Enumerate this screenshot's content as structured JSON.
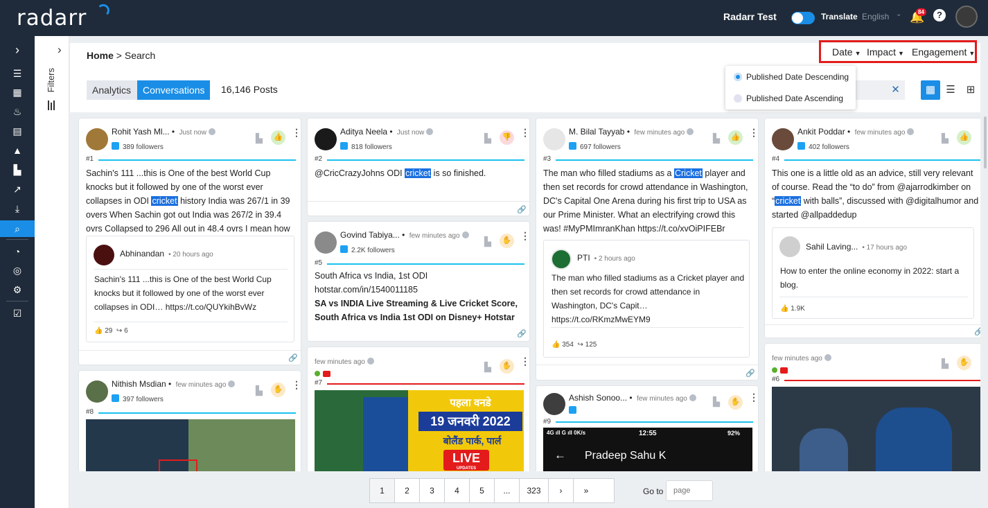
{
  "app": {
    "logo": "radarr",
    "account": "Radarr Test",
    "translate_label": "Translate",
    "language": "English",
    "notification_count": "84",
    "accent": "#1a8ee6"
  },
  "breadcrumb": {
    "home": "Home",
    "separator": ">",
    "current": "Search"
  },
  "filters_label": "Filters",
  "tabs": [
    "Analytics",
    "Conversations"
  ],
  "active_tab": "Conversations",
  "posts_count": "16,146 Posts",
  "sort": {
    "labels": [
      "Date",
      "Impact",
      "Engagement"
    ],
    "options": [
      "Published Date Descending",
      "Published Date Ascending"
    ],
    "selected": "Published Date Descending"
  },
  "posts": [
    {
      "name": "Rohit Yash Ml...",
      "time": "Just now",
      "followers": "389 followers",
      "num": "#1",
      "pre": "Sachin's 111 ...this is One of the best World Cup knocks but it followed by one of the worst ever collapses in ODI ",
      "hl": "cricket",
      "post": " history India was 267/1 in 39 overs When Sachin got out India was 267/2 in 39.4 ovrs Collapsed to 296 All out in 48.4 ovrs I mean how could they 😭😂",
      "quote": {
        "name": "Abhinandan",
        "time": "20 hours ago",
        "text": "Sachin's 111 ...this is One of the best World Cup knocks but it followed by one of the worst ever collapses in ODI… https://t.co/QUYkihBvWz",
        "likes": "29",
        "shares": "6"
      }
    },
    {
      "name": "Aditya Neela",
      "time": "Just now",
      "followers": "818 followers",
      "num": "#2",
      "pre": "@CricCrazyJohns ODI ",
      "hl": "cricket",
      "post": " is so finished."
    },
    {
      "name": "M. Bilal Tayyab",
      "time": "few minutes ago",
      "followers": "697 followers",
      "num": "#3",
      "pre": "The man who filled stadiums as a ",
      "hl": "Cricket",
      "post": " player and then set records for crowd attendance in Washington, DC's Capital One Arena during his first trip to USA as our Prime Minister. What an electrifying crowd this was! #MyPMImranKhan https://t.co/xvOiPIFEBr",
      "quote": {
        "name": "PTI",
        "time": "2 hours ago",
        "text": "The man who filled stadiums as a Cricket player and then set records for crowd attendance in Washington, DC's Capit… https://t.co/RKmzMwEYM9",
        "likes": "354",
        "shares": "125"
      }
    },
    {
      "name": "Ankit Poddar",
      "time": "few minutes ago",
      "followers": "402 followers",
      "num": "#4",
      "pre": "This one is a little old as an advice, still very relevant of course. Read the “to do” from @ajarrodkimber on “",
      "hl": "cricket",
      "post": " with balls”, discussed with @digitalhumor and started @allpaddedup",
      "quote": {
        "name": "Sahil Laving...",
        "time": "17 hours ago",
        "text": "How to enter the online economy in 2022: start a blog.",
        "likes": "1.9K"
      }
    },
    {
      "name": "Govind Tabiya...",
      "time": "few minutes ago",
      "followers": "2.2K followers",
      "num": "#5",
      "text": "South Africa vs India, 1st ODI hotstar.com/in/1540011185",
      "bold": "SA vs INDIA Live Streaming & Live Cricket Score, South Africa vs India 1st ODI on Disney+ Hotstar"
    },
    {
      "time": "few minutes ago",
      "num": "#6"
    },
    {
      "time": "few minutes ago",
      "num": "#7",
      "banner": {
        "line1": "पहला वनडे",
        "line2": "19 जनवरी 2022",
        "line3": "बोलैंड पार्क, पार्ल",
        "live": "LIVE",
        "updates": "UPDATES"
      }
    },
    {
      "name": "Nithish Msdian",
      "time": "few minutes ago",
      "followers": "397 followers",
      "num": "#8"
    },
    {
      "name": "Ashish Sonoo...",
      "time": "few minutes ago",
      "num": "#9",
      "phone": {
        "status": "4G ıll G ıll 0K/s",
        "clock": "12:55",
        "battery": "92%",
        "title": "Pradeep Sahu K"
      }
    }
  ],
  "pagination": {
    "pages": [
      "1",
      "2",
      "3",
      "4",
      "5",
      "...",
      "323"
    ],
    "next": "›",
    "last": "»",
    "goto_label": "Go to",
    "placeholder": "page"
  }
}
